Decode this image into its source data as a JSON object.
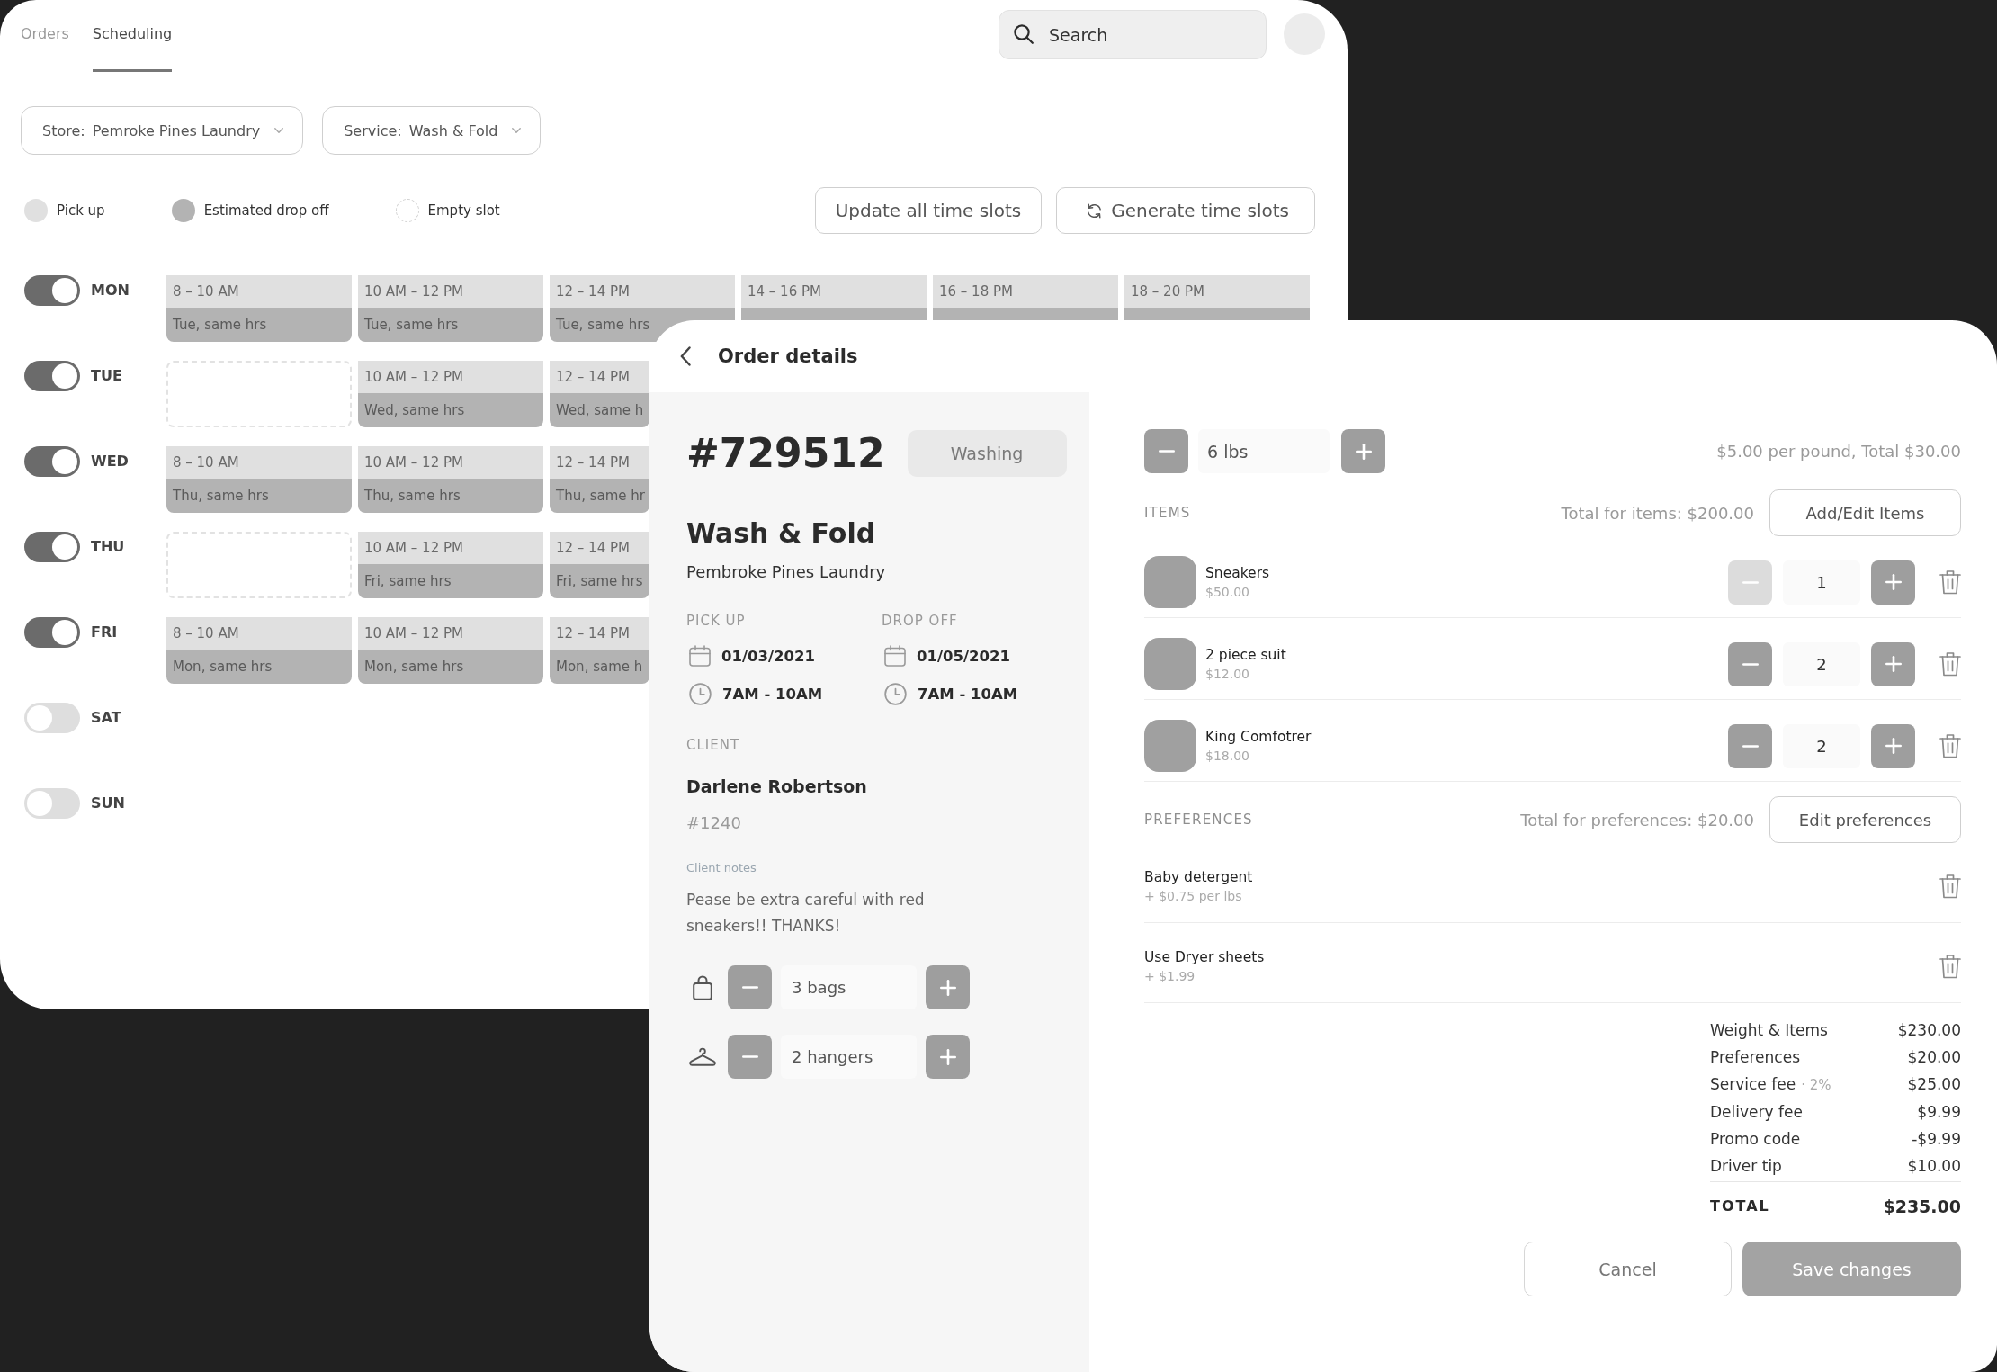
{
  "scheduling": {
    "tabs": [
      {
        "label": "Orders",
        "selected": false
      },
      {
        "label": "Scheduling",
        "selected": true
      }
    ],
    "search": {
      "placeholder": "Search"
    },
    "filters": [
      {
        "label": "Store:",
        "value": "Pemroke Pines Laundry"
      },
      {
        "label": "Service:",
        "value": "Wash & Fold"
      }
    ],
    "legend": [
      {
        "kind": "pickup",
        "label": "Pick up",
        "color": "#e0e0e0"
      },
      {
        "kind": "dropoff",
        "label": "Estimated drop off",
        "color": "#b3b3b3"
      },
      {
        "kind": "empty",
        "label": "Empty slot"
      }
    ],
    "buttons": [
      {
        "kind": "plain",
        "label": "Update all time slots"
      },
      {
        "kind": "refresh",
        "label": "Generate time slots"
      }
    ],
    "days": [
      {
        "label": "MON",
        "on": true,
        "slots": [
          {
            "kind": "filled",
            "pickup": "8 – 10 AM",
            "dropoff": "Tue, same hrs"
          },
          {
            "kind": "filled",
            "pickup": "10 AM – 12 PM",
            "dropoff": "Tue, same hrs"
          },
          {
            "kind": "filled",
            "pickup": "12 – 14 PM",
            "dropoff": "Tue, same hrs"
          },
          {
            "kind": "filled",
            "pickup": "14 – 16 PM"
          },
          {
            "kind": "filled",
            "pickup": "16 – 18 PM"
          },
          {
            "kind": "filled",
            "pickup": "18 – 20 PM"
          }
        ]
      },
      {
        "label": "TUE",
        "on": true,
        "slots": [
          {
            "kind": "empty"
          },
          {
            "kind": "filled",
            "pickup": "10 AM – 12 PM",
            "dropoff": "Wed, same hrs"
          },
          {
            "kind": "filled",
            "pickup": "12 – 14 PM",
            "dropoff": "Wed, same h"
          }
        ]
      },
      {
        "label": "WED",
        "on": true,
        "slots": [
          {
            "kind": "filled",
            "pickup": "8 – 10 AM",
            "dropoff": "Thu, same hrs"
          },
          {
            "kind": "filled",
            "pickup": "10 AM – 12 PM",
            "dropoff": "Thu, same hrs"
          },
          {
            "kind": "filled",
            "pickup": "12 – 14 PM",
            "dropoff": "Thu, same hr"
          }
        ]
      },
      {
        "label": "THU",
        "on": true,
        "slots": [
          {
            "kind": "empty"
          },
          {
            "kind": "filled",
            "pickup": "10 AM – 12 PM",
            "dropoff": "Fri, same hrs"
          },
          {
            "kind": "filled",
            "pickup": "12 – 14 PM",
            "dropoff": "Fri, same hrs"
          }
        ]
      },
      {
        "label": "FRI",
        "on": true,
        "slots": [
          {
            "kind": "filled",
            "pickup": "8 – 10 AM",
            "dropoff": "Mon, same hrs"
          },
          {
            "kind": "filled",
            "pickup": "10 AM – 12 PM",
            "dropoff": "Mon, same hrs"
          },
          {
            "kind": "filled",
            "pickup": "12 – 14 PM",
            "dropoff": "Mon, same h"
          }
        ]
      },
      {
        "label": "SAT",
        "on": false
      },
      {
        "label": "SUN",
        "on": false
      }
    ]
  },
  "order": {
    "title": "Order details",
    "number": "#729512",
    "status": "Washing",
    "service": "Wash & Fold",
    "store": "Pembroke Pines Laundry",
    "schedule": [
      {
        "label": "PICK UP",
        "date": "01/03/2021",
        "time": "7AM - 10AM"
      },
      {
        "label": "DROP OFF",
        "date": "01/05/2021",
        "time": "7AM - 10AM"
      }
    ],
    "client": {
      "label": "CLIENT",
      "name": "Darlene Robertson",
      "number": "#1240",
      "notes_label": "Client notes",
      "notes": "Pease be extra careful with red sneakers!! THANKS!"
    },
    "counters": [
      {
        "kind": "bag",
        "value": "3 bags"
      },
      {
        "kind": "hanger",
        "value": "2 hangers"
      }
    ],
    "weight": {
      "value": "6 lbs",
      "price": "$5.00 per pound, Total $30.00"
    },
    "items": {
      "heading": "ITEMS",
      "total": "Total for items: $200.00",
      "button": "Add/Edit Items",
      "rows": [
        {
          "name": "Sneakers",
          "price": "$50.00",
          "quantity": "1",
          "minus_disabled": true
        },
        {
          "name": "2 piece suit",
          "price": "$12.00",
          "quantity": "2",
          "minus_disabled": false
        },
        {
          "name": "King Comfotrer",
          "price": "$18.00",
          "quantity": "2",
          "minus_disabled": false
        }
      ]
    },
    "preferences": {
      "heading": "PREFERENCES",
      "total": "Total for preferences: $20.00",
      "button": "Edit preferences",
      "rows": [
        {
          "name": "Baby detergent",
          "price": "+ $0.75 per lbs"
        },
        {
          "name": "Use Dryer sheets",
          "price": "+ $1.99"
        }
      ]
    },
    "summary": [
      {
        "label": "Weight & Items",
        "value": "$230.00"
      },
      {
        "label": "Preferences",
        "value": "$20.00"
      },
      {
        "label": "Service fee",
        "note": "· 2%",
        "value": "$25.00"
      },
      {
        "label": "Delivery fee",
        "value": "$9.99"
      },
      {
        "label": "Promo code",
        "value": "-$9.99"
      },
      {
        "label": "Driver tip",
        "value": "$10.00"
      }
    ],
    "total": {
      "label": "TOTAL",
      "value": "$235.00"
    },
    "actions": [
      {
        "kind": "outline",
        "label": "Cancel"
      },
      {
        "kind": "filled",
        "label": "Save changes"
      }
    ]
  }
}
